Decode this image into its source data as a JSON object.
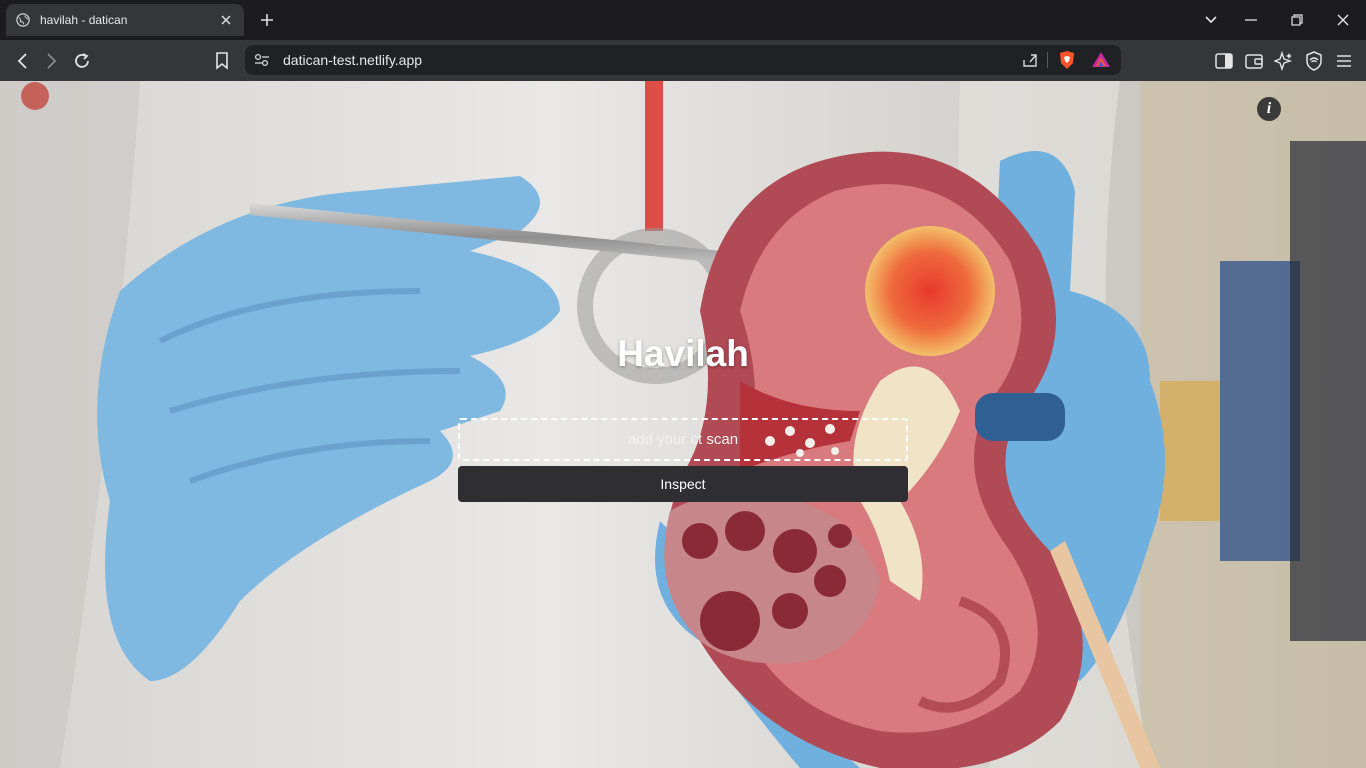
{
  "browser": {
    "tab": {
      "title": "havilah - datican"
    },
    "address": {
      "url": "datican-test.netlify.app"
    }
  },
  "page": {
    "heading": "Havilah",
    "upload": {
      "placeholder": "add your ct scan"
    },
    "inspect_button": {
      "label": "Inspect"
    },
    "info_button": {
      "label": "i"
    }
  },
  "colors": {
    "accent_button": "#2e2e33",
    "glove": "#7fb8e0",
    "kidney": "#b04a55"
  }
}
